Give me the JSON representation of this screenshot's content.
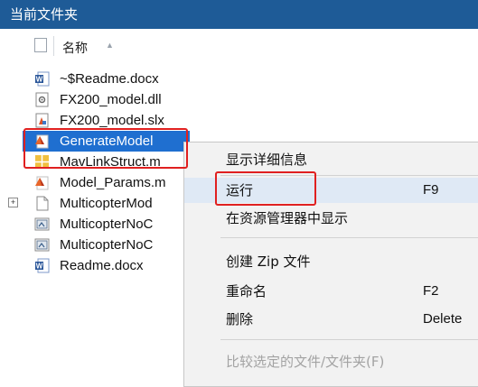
{
  "panel": {
    "title": "当前文件夹"
  },
  "header": {
    "name_label": "名称",
    "sort_arrow": "▲"
  },
  "files": [
    {
      "name": "~$Readme.docx",
      "icon": "word-doc-icon"
    },
    {
      "name": "FX200_model.dll",
      "icon": "dll-file-icon"
    },
    {
      "name": "FX200_model.slx",
      "icon": "simulink-model-icon"
    },
    {
      "name": "GenerateModel",
      "icon": "matlab-script-icon",
      "selected": true
    },
    {
      "name": "MavLinkStruct.m",
      "icon": "mat-struct-icon"
    },
    {
      "name": "Model_Params.m",
      "icon": "matlab-script-icon"
    },
    {
      "name": "MulticopterMod",
      "icon": "folder-file-icon",
      "expandable": true
    },
    {
      "name": "MulticopterNoC",
      "icon": "system-file-icon"
    },
    {
      "name": "MulticopterNoC",
      "icon": "system-file-icon"
    },
    {
      "name": "Readme.docx",
      "icon": "word-doc-icon"
    }
  ],
  "context_menu": {
    "show_details": "显示详细信息",
    "run": "运行",
    "run_shortcut": "F9",
    "show_in_explorer": "在资源管理器中显示",
    "create_zip": "创建 Zip 文件",
    "rename": "重命名",
    "rename_shortcut": "F2",
    "delete": "删除",
    "delete_shortcut": "Delete",
    "compare": "比较选定的文件/文件夹(F)"
  },
  "colors": {
    "title_bg": "#1e5b97",
    "selection": "#1f6fd0",
    "highlight": "#e02020"
  }
}
